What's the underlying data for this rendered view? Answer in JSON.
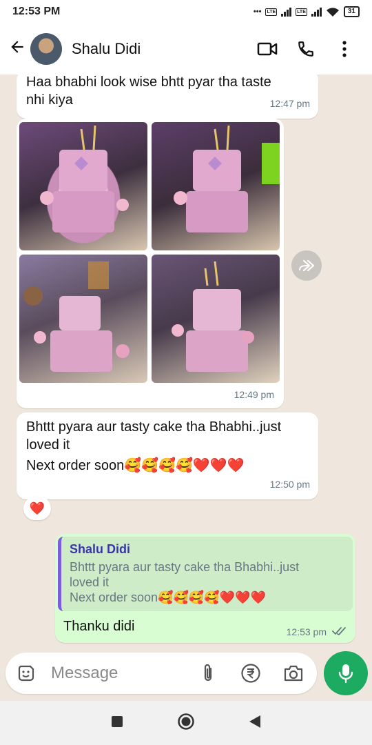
{
  "status": {
    "time": "12:53 PM",
    "battery": "31",
    "lte_label": "LTE"
  },
  "header": {
    "contact_name": "Shalu Didi"
  },
  "messages": [
    {
      "direction": "incoming",
      "lines": [
        "Haa bhabhi look wise bhtt pyar tha taste",
        "nhi kiya"
      ],
      "time": "12:47 pm"
    },
    {
      "direction": "incoming",
      "type": "photo_album",
      "photo_count": 4,
      "time": "12:49 pm"
    },
    {
      "direction": "incoming",
      "lines": [
        "Bhttt pyara aur tasty cake tha Bhabhi..just",
        "loved it",
        "Next order soon🥰🥰🥰🥰❤️❤️❤️"
      ],
      "time": "12:50 pm",
      "reaction": "❤️"
    },
    {
      "direction": "outgoing",
      "quote": {
        "author": "Shalu Didi",
        "lines": [
          "Bhttt pyara aur tasty cake tha Bhabhi..just",
          "loved it",
          "Next order soon🥰🥰🥰🥰❤️❤️❤️"
        ]
      },
      "text": "Thanku didi",
      "time": "12:53 pm",
      "status": "read"
    }
  ],
  "composer": {
    "placeholder": "Message"
  },
  "colors": {
    "chat_bg": "#efe7dd",
    "outgoing_bubble": "#d9fdd3",
    "incoming_bubble": "#ffffff",
    "accent_green": "#1daa61",
    "quote_bar": "#7b5dde",
    "timestamp": "#667781",
    "read_ticks": "#667781"
  },
  "icons": {
    "header": [
      "back-arrow-icon",
      "video-call-icon",
      "phone-icon",
      "more-options-icon"
    ],
    "composer": [
      "sticker-icon",
      "attach-icon",
      "rupee-payment-icon",
      "camera-icon",
      "mic-icon"
    ],
    "navigation": [
      "recents-square-icon",
      "home-circle-icon",
      "back-triangle-icon"
    ]
  }
}
